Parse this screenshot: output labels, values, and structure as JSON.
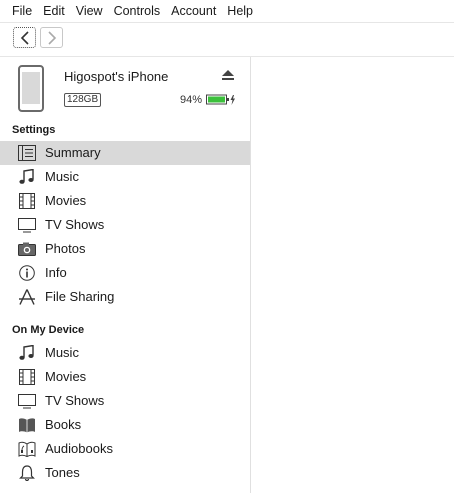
{
  "menubar": {
    "items": [
      "File",
      "Edit",
      "View",
      "Controls",
      "Account",
      "Help"
    ]
  },
  "device": {
    "name": "Higospot's iPhone",
    "capacity": "128GB",
    "battery_percent": "94%"
  },
  "sections": {
    "settings_title": "Settings",
    "settings_items": [
      {
        "label": "Summary",
        "icon": "summary-icon"
      },
      {
        "label": "Music",
        "icon": "music-icon"
      },
      {
        "label": "Movies",
        "icon": "movies-icon"
      },
      {
        "label": "TV Shows",
        "icon": "tv-icon"
      },
      {
        "label": "Photos",
        "icon": "camera-icon"
      },
      {
        "label": "Info",
        "icon": "info-icon"
      },
      {
        "label": "File Sharing",
        "icon": "app-store-icon"
      }
    ],
    "device_title": "On My Device",
    "device_items": [
      {
        "label": "Music",
        "icon": "music-icon"
      },
      {
        "label": "Movies",
        "icon": "movies-icon"
      },
      {
        "label": "TV Shows",
        "icon": "tv-icon"
      },
      {
        "label": "Books",
        "icon": "book-icon"
      },
      {
        "label": "Audiobooks",
        "icon": "audiobook-icon"
      },
      {
        "label": "Tones",
        "icon": "bell-icon"
      }
    ]
  },
  "colors": {
    "selected_bg": "#d9d9d9",
    "battery_green": "#3cc03c"
  }
}
